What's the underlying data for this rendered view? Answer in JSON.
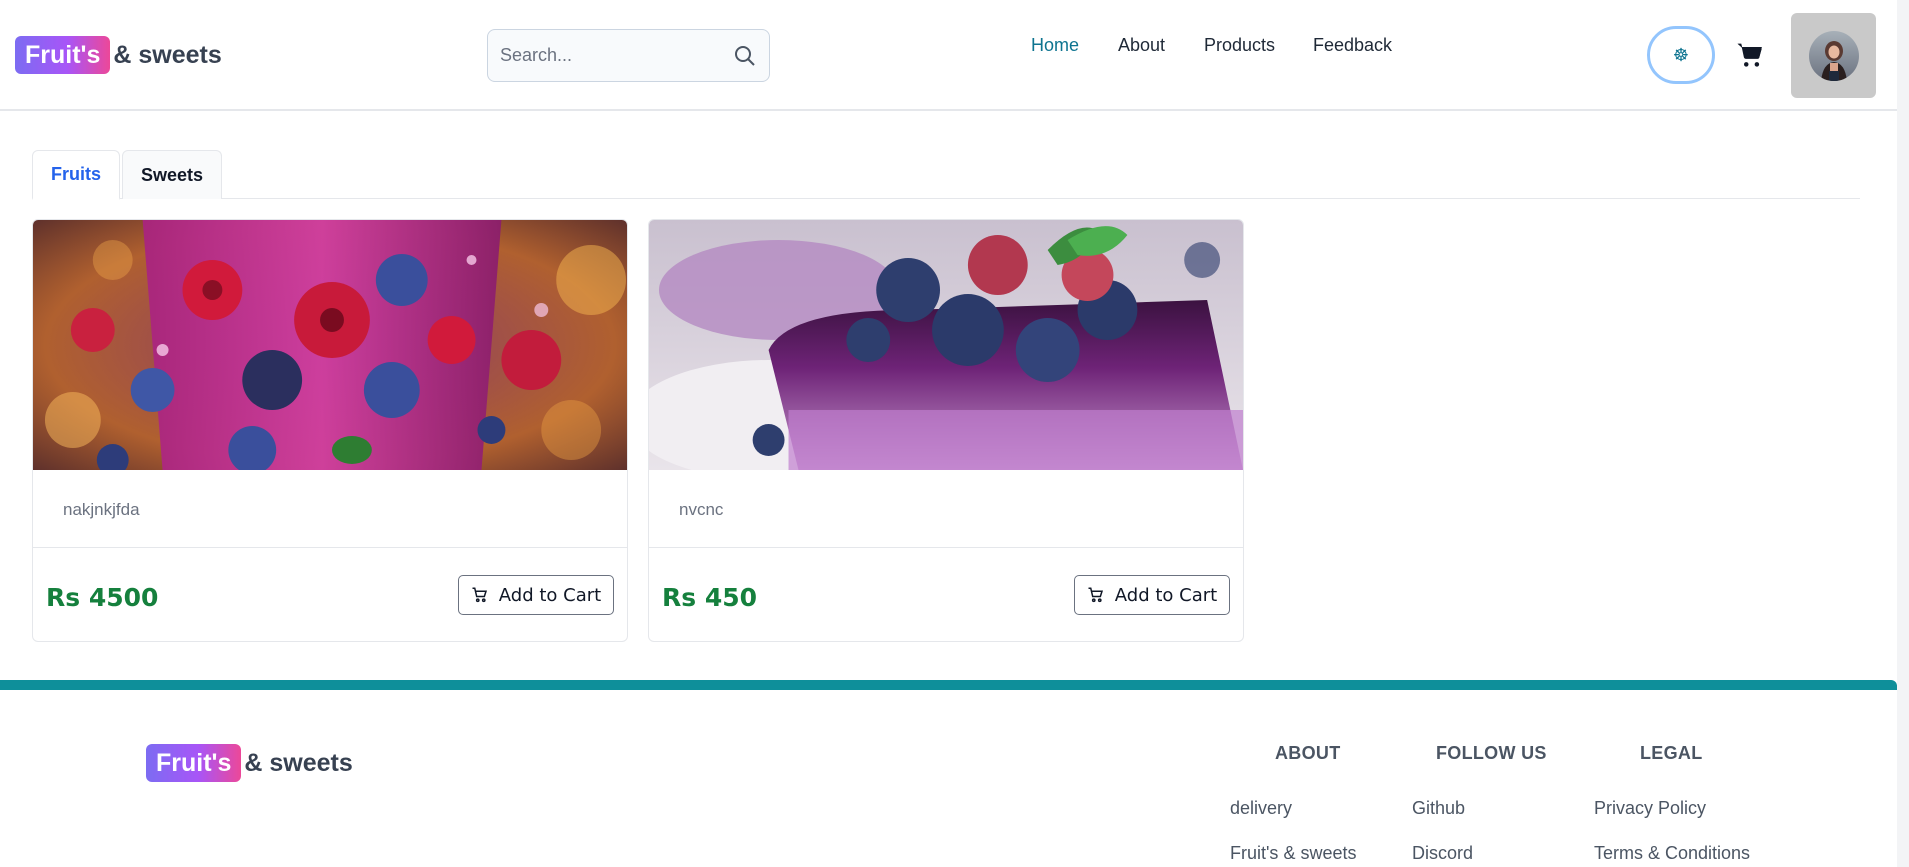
{
  "brand": {
    "pill": "Fruit's",
    "rest": "& sweets"
  },
  "search": {
    "placeholder": "Search..."
  },
  "nav": [
    {
      "label": "Home"
    },
    {
      "label": "About"
    },
    {
      "label": "Products"
    },
    {
      "label": "Feedback"
    }
  ],
  "header_actions": {
    "theme_icon": "☸",
    "cart_icon": "cart-icon"
  },
  "tabs": [
    {
      "label": "Fruits",
      "active": true
    },
    {
      "label": "Sweets",
      "active": false
    }
  ],
  "products": [
    {
      "description": "nakjnkjfda",
      "price": "Rs 4500",
      "button": "Add to Cart"
    },
    {
      "description": "nvcnc",
      "price": "Rs 450",
      "button": "Add to Cart"
    }
  ],
  "footer": {
    "brand": {
      "pill": "Fruit's",
      "rest": "& sweets"
    },
    "columns": [
      {
        "heading": "ABOUT",
        "links": [
          "delivery",
          "Fruit's & sweets"
        ]
      },
      {
        "heading": "FOLLOW US",
        "links": [
          "Github",
          "Discord"
        ]
      },
      {
        "heading": "LEGAL",
        "links": [
          "Privacy Policy",
          "Terms & Conditions"
        ]
      }
    ]
  },
  "colors": {
    "accent": "#0e7490",
    "price": "#15803d",
    "footer_bar": "#0e8f9a",
    "tab_active": "#2563eb"
  }
}
